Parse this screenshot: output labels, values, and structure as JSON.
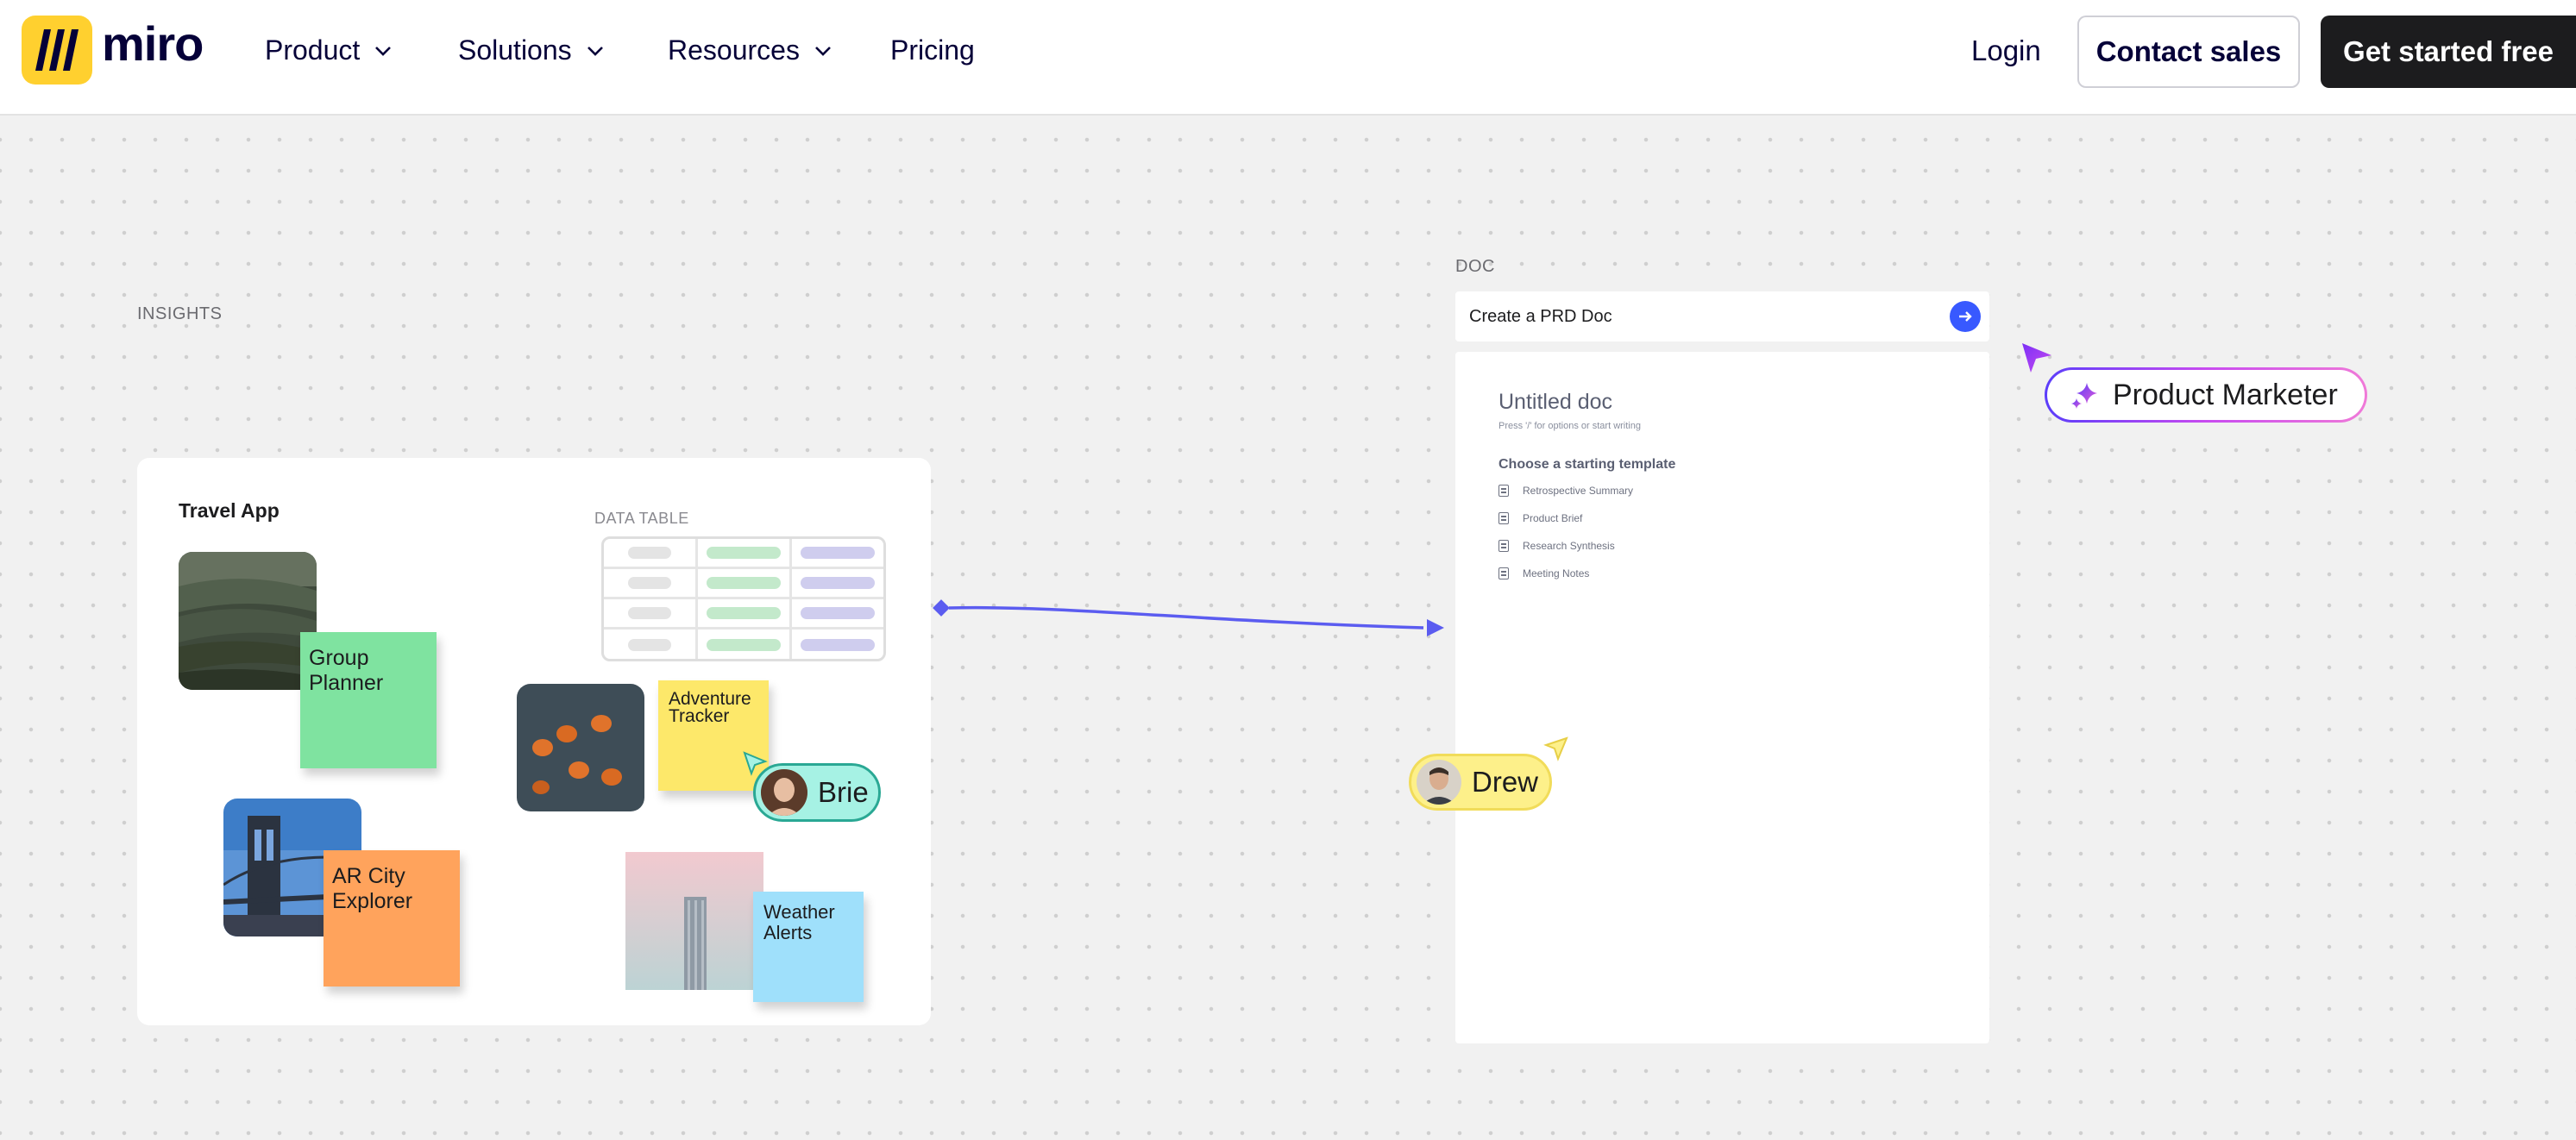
{
  "header": {
    "logo_text": "miro",
    "nav": [
      {
        "label": "Product",
        "has_dropdown": true
      },
      {
        "label": "Solutions",
        "has_dropdown": true
      },
      {
        "label": "Resources",
        "has_dropdown": true
      },
      {
        "label": "Pricing",
        "has_dropdown": false
      }
    ],
    "login_label": "Login",
    "contact_label": "Contact sales",
    "cta_label": "Get started free"
  },
  "canvas": {
    "insights": {
      "section_label": "INSIGHTS",
      "board_title": "Travel App",
      "data_table_label": "DATA TABLE",
      "data_table_rows": 4,
      "stickies": [
        {
          "text": "Group Planner",
          "color": "#7fe3a0"
        },
        {
          "text": "Adventure Tracker",
          "color": "#fde86a"
        },
        {
          "text": "AR City Explorer",
          "color": "#ffa35c"
        },
        {
          "text": "Weather Alerts",
          "color": "#9fe0fb"
        }
      ],
      "cursor_brie": {
        "name": "Brie",
        "color": "#a6f2e4"
      }
    },
    "doc": {
      "section_label": "DOC",
      "prompt_text": "Create a PRD Doc",
      "title": "Untitled doc",
      "hint": "Press '/' for options or start writing",
      "choose_label": "Choose a starting template",
      "templates": [
        "Retrospective Summary",
        "Product Brief",
        "Research Synthesis",
        "Meeting Notes"
      ]
    },
    "cursor_drew": {
      "name": "Drew",
      "color": "#fdf08a"
    },
    "product_marketer": {
      "label": "Product Marketer"
    }
  },
  "colors": {
    "brand_yellow": "#ffd02f",
    "connector": "#5b5cf0",
    "primary_blue": "#3859ff"
  }
}
